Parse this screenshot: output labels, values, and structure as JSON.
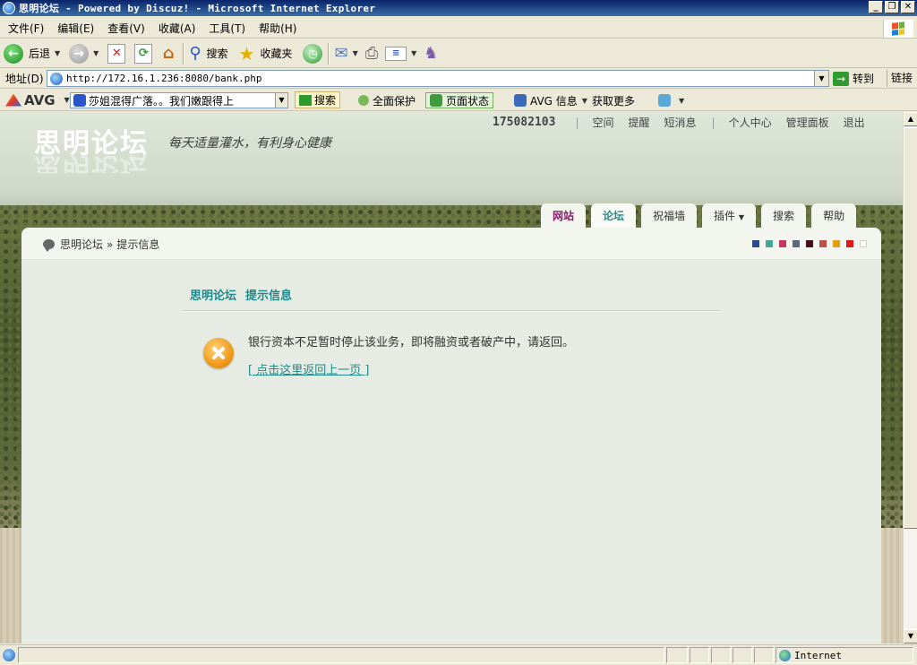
{
  "window": {
    "title": "思明论坛 - Powered by Discuz! - Microsoft Internet Explorer",
    "buttons": [
      "_",
      "❐",
      "✕"
    ]
  },
  "menu": [
    "文件(F)",
    "编辑(E)",
    "查看(V)",
    "收藏(A)",
    "工具(T)",
    "帮助(H)"
  ],
  "toolbar": {
    "back_label": "后退",
    "search_label": "搜索",
    "favorites_label": "收藏夹"
  },
  "address": {
    "label": "地址(D)",
    "url": "http://172.16.1.236:8080/bank.php",
    "go_label": "转到",
    "links_label": "链接"
  },
  "avg": {
    "logo": "AVG",
    "search_value": "莎姐混得广落。。我们嫩跟得上",
    "search_btn": "搜索",
    "protect": "全面保护",
    "page_status": "页面状态",
    "info": "AVG 信息",
    "more": "获取更多"
  },
  "site": {
    "title": "思明论坛",
    "slogan": "每天适量灌水，有利身心健康",
    "user": "175082103",
    "nav1": [
      "空间",
      "提醒",
      "短消息"
    ],
    "nav2": [
      "个人中心",
      "管理面板",
      "退出"
    ],
    "tabs": [
      "网站",
      "论坛",
      "祝福墙",
      "插件",
      "搜索",
      "帮助"
    ],
    "active_tab": "论坛"
  },
  "breadcrumb": {
    "home": "思明论坛",
    "sep": "»",
    "current": "提示信息"
  },
  "swatches": [
    "#2a4a8a",
    "#4aa58e",
    "#c7356a",
    "#5a6a7a",
    "#4a1020",
    "#c0504d",
    "#e89a1a",
    "#e01a1a",
    "#ffffff"
  ],
  "message": {
    "title_site": "思明论坛",
    "title_text": "提示信息",
    "body": "银行资本不足暂时停止该业务，即将融资或者破产中，请返回。",
    "back_link": "[ 点击这里返回上一页 ]"
  },
  "status": {
    "zone": "Internet"
  }
}
